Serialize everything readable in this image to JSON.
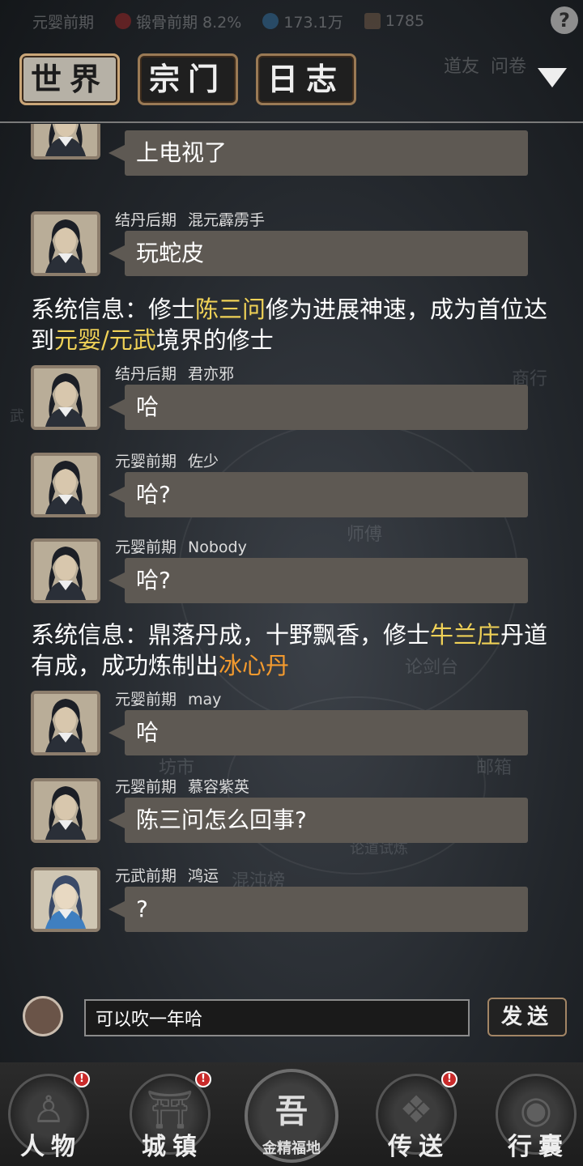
{
  "status_bar": {
    "realm": "元婴前期",
    "tempering": "锻骨前期 8.2%",
    "spirit": "173.1万",
    "power": "1785",
    "help_label": "?"
  },
  "tabs": [
    {
      "label": "世界",
      "active": true
    },
    {
      "label": "宗门",
      "active": false
    },
    {
      "label": "日志",
      "active": false
    }
  ],
  "top_right": {
    "friends": "道友",
    "ask": "问卷"
  },
  "map_labels": [
    "商行",
    "师傅",
    "论剑台",
    "坊市",
    "邮箱",
    "论道试炼",
    "混沌榜",
    "武"
  ],
  "messages": [
    {
      "type": "chat",
      "realm": "",
      "name": "",
      "text": "上电视了",
      "avatar": "dark"
    },
    {
      "type": "chat",
      "realm": "结丹后期",
      "name": "混元霹雳手",
      "text": "玩蛇皮",
      "avatar": "dark"
    },
    {
      "type": "system",
      "parts": [
        {
          "t": "系统信息：修士",
          "c": ""
        },
        {
          "t": "陈三问",
          "c": "y"
        },
        {
          "t": "修为进展神速，成为首位达到",
          "c": ""
        },
        {
          "t": "元婴/元武",
          "c": "y"
        },
        {
          "t": "境界的修士",
          "c": ""
        }
      ]
    },
    {
      "type": "chat",
      "realm": "结丹后期",
      "name": "君亦邪",
      "text": "哈",
      "avatar": "dark"
    },
    {
      "type": "chat",
      "realm": "元婴前期",
      "name": "佐少",
      "text": "哈?",
      "avatar": "dark"
    },
    {
      "type": "chat",
      "realm": "元婴前期",
      "name": "Nobody",
      "text": "哈?",
      "avatar": "dark"
    },
    {
      "type": "system",
      "parts": [
        {
          "t": "系统信息：鼎落丹成，十野飘香，修士",
          "c": ""
        },
        {
          "t": "牛兰庄",
          "c": "y"
        },
        {
          "t": "丹道有成，成功炼制出",
          "c": ""
        },
        {
          "t": "冰心丹",
          "c": "o"
        }
      ]
    },
    {
      "type": "chat",
      "realm": "元婴前期",
      "name": "may",
      "text": "哈",
      "avatar": "dark"
    },
    {
      "type": "chat",
      "realm": "元婴前期",
      "name": "慕容紫英",
      "text": "陈三问怎么回事?",
      "avatar": "dark"
    },
    {
      "type": "chat",
      "realm": "元武前期",
      "name": "鸿运",
      "text": "?",
      "avatar": "blue"
    }
  ],
  "input": {
    "value": "可以吹一年哈",
    "placeholder": ""
  },
  "send_label": "发送",
  "nav": [
    {
      "label": "人物",
      "badge": "!"
    },
    {
      "label": "城镇",
      "badge": "!"
    },
    {
      "label": "金精福地",
      "glyph": "吾",
      "badge": ""
    },
    {
      "label": "传送",
      "badge": "!"
    },
    {
      "label": "行囊",
      "badge": ""
    }
  ],
  "colors": {
    "highlight_name": "#f0d257",
    "highlight_item": "#f39a2e",
    "bubble": "#5e5953",
    "badge": "#c92a2a"
  }
}
